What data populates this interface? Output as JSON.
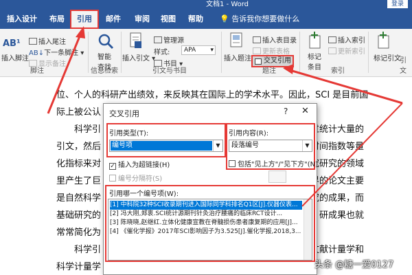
{
  "window": {
    "title": "文档1 - Word",
    "login": "登录"
  },
  "tabs": [
    "插入",
    "设计",
    "布局",
    "引用",
    "邮件",
    "审阅",
    "视图",
    "帮助"
  ],
  "tell_me": "告诉我你想要做什么",
  "ribbon": {
    "footnote": {
      "insert_footnote": "插入脚注",
      "insert_endnote": "插入尾注",
      "next_footnote": "下一条脚注",
      "show_notes": "显示备注",
      "group": "脚注",
      "ab_label": "AB¹"
    },
    "smart_lookup": {
      "label1": "智能",
      "label2": "查找",
      "group": "信息检索"
    },
    "citation": {
      "insert_citation": "插入引文",
      "manage_sources": "管理源",
      "style_label": "样式:",
      "style_value": "APA",
      "bibliography": "书目",
      "group": "引文与书目"
    },
    "captions": {
      "insert_caption": "插入题注",
      "insert_table_of_figures": "插入表目录",
      "update_table": "更新表格",
      "cross_reference": "交叉引用",
      "group": "题注"
    },
    "index": {
      "mark_entry1": "标记",
      "mark_entry2": "条目",
      "insert_index": "插入索引",
      "update_index": "更新索引",
      "group": "索引"
    },
    "toa": {
      "mark_citation": "标记引文",
      "group": "引文"
    }
  },
  "document": {
    "lines": [
      "位、个人的科研产出绩效，来反映其在国际上的学术水平。因此，SCI 是目前国",
      "际上被公认",
      "科学引",
      "引文，然后",
      "化指标来对",
      "里产生了巨",
      "是自然科学",
      "基础研究的",
      "常常简化为",
      "科学引",
      "科学计量学"
    ],
    "right_fragments": [
      "过统计大量的",
      "时间指数等量",
      "究研究的领域",
      "界的论文主要",
      "究的成果，而",
      "研成果也就",
      "文献计量学和"
    ]
  },
  "dialog": {
    "title": "交叉引用",
    "help": "?",
    "close": "✕",
    "ref_type_label": "引用类型(T):",
    "ref_type_value": "编号项",
    "ref_content_label": "引用内容(R):",
    "ref_content_value": "段落编号",
    "insert_hyperlink": "插入为超链接(H)",
    "include_above_below": "包括\"见上方\"/\"见下方\"(N)",
    "separator_label": "编号分隔符(S)",
    "which_item_label": "引用哪一个编号项(W):",
    "items": [
      "[1] 中科院32种SCI收录期刊进入国际同学科排名Q1区[J].仪器仪表...",
      "[2] 冯大刚,郑衷.SCI统计源期刊针灸治疗腰痛的临床RCT设计...",
      "[3] 陈晓晓,赵继红.立体化健康宣教在脊髓损伤患者康复期的应用[J]...",
      "[4] 《催化学报》2017年SCI影响因子为3.525[J].催化学报,2018,3..."
    ]
  },
  "watermark": "头条 @糖一爱0127",
  "colors": {
    "word_blue": "#2b579a",
    "highlight_red": "#e53935",
    "selection_blue": "#0078d7"
  }
}
